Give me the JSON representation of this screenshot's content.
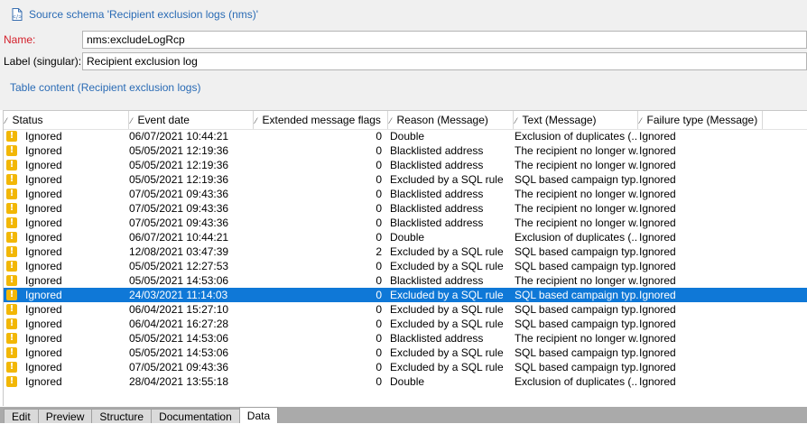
{
  "header": {
    "title": "Source schema 'Recipient exclusion logs (nms)'"
  },
  "form": {
    "name_label": "Name:",
    "name_value": "nms:excludeLogRcp",
    "label_label": "Label (singular):",
    "label_value": "Recipient exclusion log",
    "section_title": "Table content (Recipient exclusion logs)"
  },
  "grid": {
    "columns": [
      "Status",
      "Event date",
      "Extended message flags",
      "Reason (Message)",
      "Text (Message)",
      "Failure type (Message)"
    ],
    "selected_row_index": 11,
    "rows": [
      {
        "status": "Ignored",
        "date": "06/07/2021 10:44:21",
        "flags": "0",
        "reason": "Double",
        "text": "Exclusion of duplicates (...",
        "failure": "Ignored"
      },
      {
        "status": "Ignored",
        "date": "05/05/2021 12:19:36",
        "flags": "0",
        "reason": "Blacklisted address",
        "text": "The recipient no longer w...",
        "failure": "Ignored"
      },
      {
        "status": "Ignored",
        "date": "05/05/2021 12:19:36",
        "flags": "0",
        "reason": "Blacklisted address",
        "text": "The recipient no longer w...",
        "failure": "Ignored"
      },
      {
        "status": "Ignored",
        "date": "05/05/2021 12:19:36",
        "flags": "0",
        "reason": "Excluded by a SQL rule",
        "text": "SQL based campaign typ...",
        "failure": "Ignored"
      },
      {
        "status": "Ignored",
        "date": "07/05/2021 09:43:36",
        "flags": "0",
        "reason": "Blacklisted address",
        "text": "The recipient no longer w...",
        "failure": "Ignored"
      },
      {
        "status": "Ignored",
        "date": "07/05/2021 09:43:36",
        "flags": "0",
        "reason": "Blacklisted address",
        "text": "The recipient no longer w...",
        "failure": "Ignored"
      },
      {
        "status": "Ignored",
        "date": "07/05/2021 09:43:36",
        "flags": "0",
        "reason": "Blacklisted address",
        "text": "The recipient no longer w...",
        "failure": "Ignored"
      },
      {
        "status": "Ignored",
        "date": "06/07/2021 10:44:21",
        "flags": "0",
        "reason": "Double",
        "text": "Exclusion of duplicates (...",
        "failure": "Ignored"
      },
      {
        "status": "Ignored",
        "date": "12/08/2021 03:47:39",
        "flags": "2",
        "reason": "Excluded by a SQL rule",
        "text": "SQL based campaign typ...",
        "failure": "Ignored"
      },
      {
        "status": "Ignored",
        "date": "05/05/2021 12:27:53",
        "flags": "0",
        "reason": "Excluded by a SQL rule",
        "text": "SQL based campaign typ...",
        "failure": "Ignored"
      },
      {
        "status": "Ignored",
        "date": "05/05/2021 14:53:06",
        "flags": "0",
        "reason": "Blacklisted address",
        "text": "The recipient no longer w...",
        "failure": "Ignored"
      },
      {
        "status": "Ignored",
        "date": "24/03/2021 11:14:03",
        "flags": "0",
        "reason": "Excluded by a SQL rule",
        "text": "SQL based campaign typ...",
        "failure": "Ignored"
      },
      {
        "status": "Ignored",
        "date": "06/04/2021 15:27:10",
        "flags": "0",
        "reason": "Excluded by a SQL rule",
        "text": "SQL based campaign typ...",
        "failure": "Ignored"
      },
      {
        "status": "Ignored",
        "date": "06/04/2021 16:27:28",
        "flags": "0",
        "reason": "Excluded by a SQL rule",
        "text": "SQL based campaign typ...",
        "failure": "Ignored"
      },
      {
        "status": "Ignored",
        "date": "05/05/2021 14:53:06",
        "flags": "0",
        "reason": "Blacklisted address",
        "text": "The recipient no longer w...",
        "failure": "Ignored"
      },
      {
        "status": "Ignored",
        "date": "05/05/2021 14:53:06",
        "flags": "0",
        "reason": "Excluded by a SQL rule",
        "text": "SQL based campaign typ...",
        "failure": "Ignored"
      },
      {
        "status": "Ignored",
        "date": "07/05/2021 09:43:36",
        "flags": "0",
        "reason": "Excluded by a SQL rule",
        "text": "SQL based campaign typ...",
        "failure": "Ignored"
      },
      {
        "status": "Ignored",
        "date": "28/04/2021 13:55:18",
        "flags": "0",
        "reason": "Double",
        "text": "Exclusion of duplicates (...",
        "failure": "Ignored"
      }
    ]
  },
  "tabs": [
    {
      "label": "Edit"
    },
    {
      "label": "Preview"
    },
    {
      "label": "Structure"
    },
    {
      "label": "Documentation"
    },
    {
      "label": "Data"
    }
  ],
  "active_tab": "Data",
  "status_icon": "warning-icon",
  "colors": {
    "accent": "#2a6bb5",
    "selection": "#0f78d7",
    "warning": "#f2b705",
    "required_label": "#d4202b"
  }
}
